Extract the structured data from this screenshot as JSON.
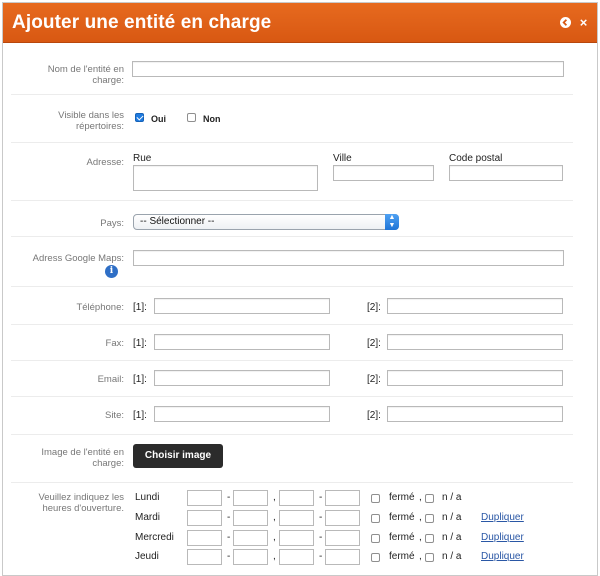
{
  "dialog": {
    "title": "Ajouter une entité en charge",
    "back_icon": "arrow-left-circle-icon",
    "close_icon": "close-icon",
    "close_glyph": "×"
  },
  "form": {
    "name_label": "Nom de l'entité en charge:",
    "visible_label": "Visible dans les répertoires:",
    "visible_yes": "Oui",
    "visible_no": "Non",
    "visible_yes_checked": true,
    "address_label": "Adresse:",
    "street_label": "Rue",
    "city_label": "Ville",
    "postal_label": "Code postal",
    "country_label": "Pays:",
    "country_value": "-- Sélectionner --",
    "maps_label": "Adress Google Maps:",
    "maps_info_icon": "info-icon",
    "phone_label": "Téléphone:",
    "fax_label": "Fax:",
    "email_label": "Email:",
    "site_label": "Site:",
    "slot1": "[1]:",
    "slot2": "[2]:",
    "image_label": "Image de l'entité en charge:",
    "choose_image_button": "Choisir image",
    "hours_label": "Veuillez indiquez les heures d'ouverture.",
    "days": [
      "Lundi",
      "Mardi",
      "Mercredi",
      "Jeudi"
    ],
    "dash": "-",
    "comma": ",",
    "closed": "fermé",
    "na": "n / a",
    "duplicate": "Dupliquer"
  }
}
